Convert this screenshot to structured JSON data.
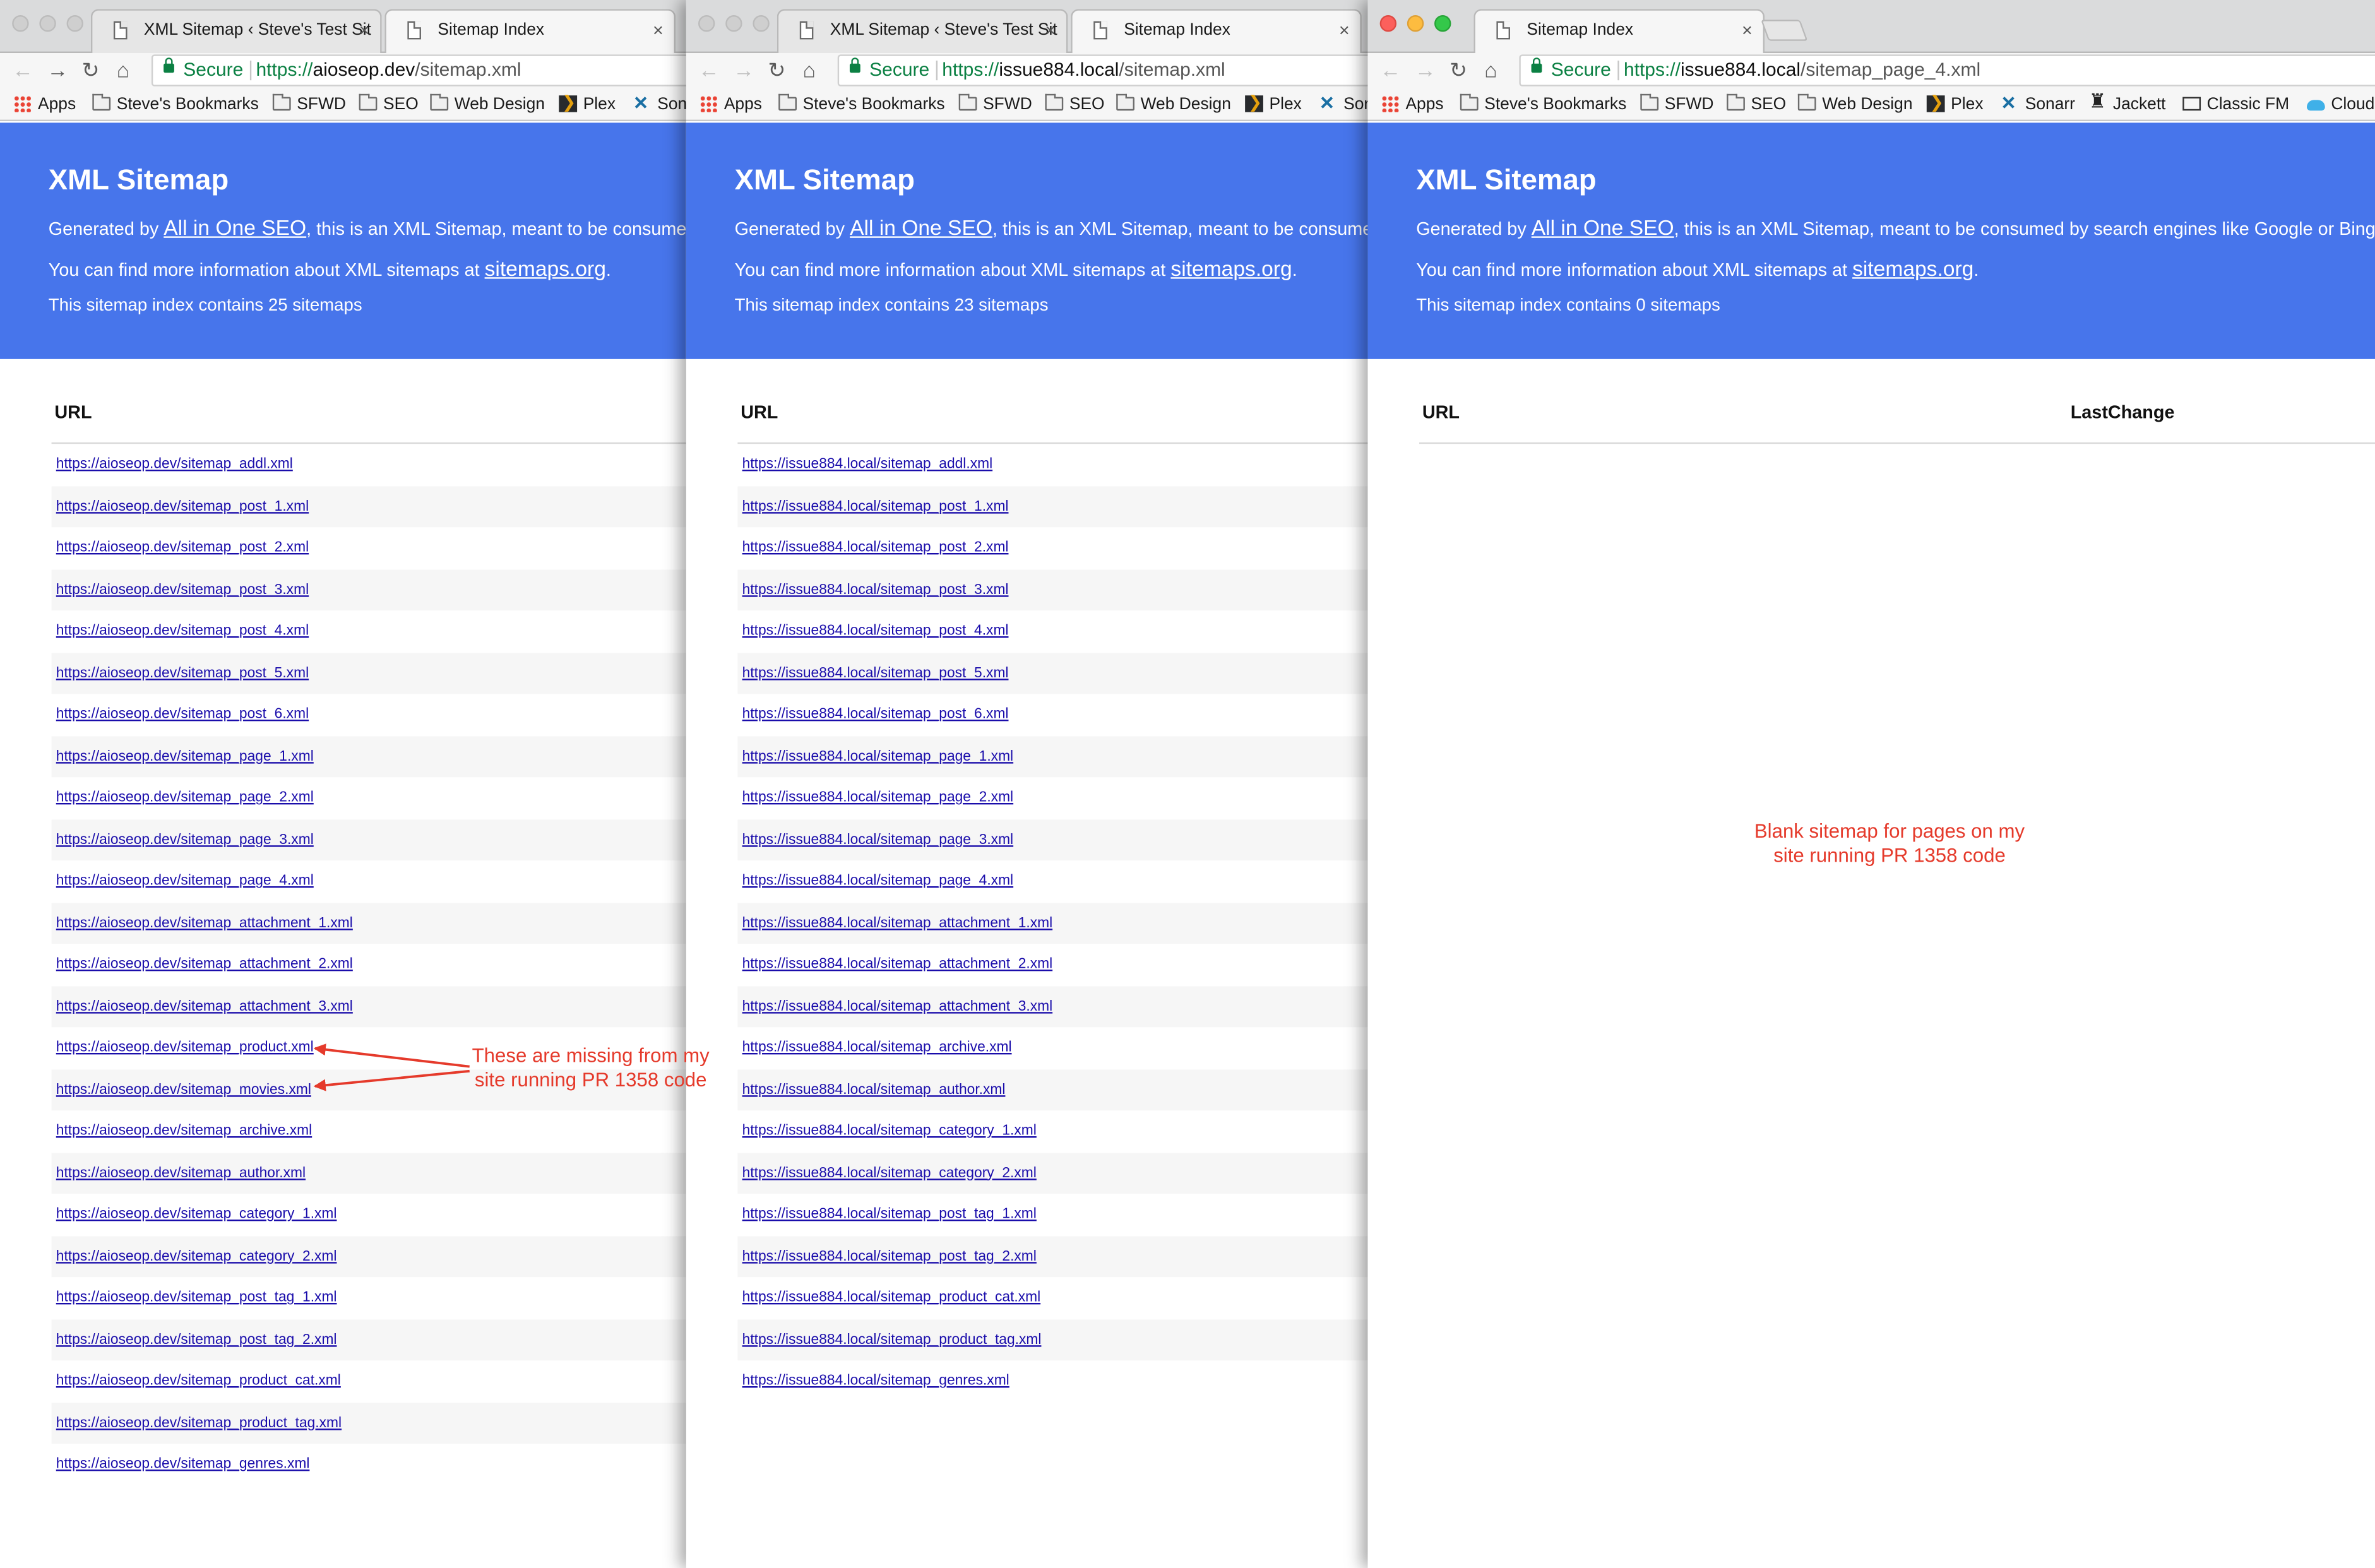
{
  "bookmarks": [
    {
      "label": "Apps",
      "icon": "apps-icon"
    },
    {
      "label": "Steve's Bookmarks",
      "icon": "folder-icon"
    },
    {
      "label": "SFWD",
      "icon": "folder-icon"
    },
    {
      "label": "SEO",
      "icon": "folder-icon"
    },
    {
      "label": "Web Design",
      "icon": "folder-icon"
    },
    {
      "label": "Plex",
      "icon": "plex-icon"
    },
    {
      "label": "Sonarr",
      "icon": "sonarr-icon"
    },
    {
      "label": "Jackett",
      "icon": "jackett-icon"
    },
    {
      "label": "Classic FM",
      "icon": "classic-fm-icon"
    },
    {
      "label": "Cloud",
      "icon": "cloud-icon"
    }
  ],
  "common": {
    "secure_label": "Secure",
    "page_title": "XML Sitemap",
    "generated_prefix": "Generated by ",
    "generator_link": "All in One SEO",
    "generated_suffix": ", this is an XML Sitemap, meant to be consumed by search engines like Google or Bing.",
    "info_prefix": "You can find more information about XML sitemaps at ",
    "info_link": "sitemaps.org",
    "info_suffix": ".",
    "col_url": "URL",
    "col_lastchange": "LastChange",
    "close_glyph": "×"
  },
  "colors": {
    "banner": "#4775eb",
    "link": "#1a0dab",
    "annotation": "#e53a2b",
    "secure": "#0b8043"
  },
  "windows": [
    {
      "tabs": [
        {
          "title": "XML Sitemap ‹ Steve's Test Site",
          "active": false
        },
        {
          "title": "Sitemap Index",
          "active": true
        }
      ],
      "url_scheme": "https://",
      "url_host": "aioseop.dev",
      "url_path": "/sitemap.xml",
      "count_text": "This sitemap index contains 25 sitemaps",
      "rows": [
        "https://aioseop.dev/sitemap_addl.xml",
        "https://aioseop.dev/sitemap_post_1.xml",
        "https://aioseop.dev/sitemap_post_2.xml",
        "https://aioseop.dev/sitemap_post_3.xml",
        "https://aioseop.dev/sitemap_post_4.xml",
        "https://aioseop.dev/sitemap_post_5.xml",
        "https://aioseop.dev/sitemap_post_6.xml",
        "https://aioseop.dev/sitemap_page_1.xml",
        "https://aioseop.dev/sitemap_page_2.xml",
        "https://aioseop.dev/sitemap_page_3.xml",
        "https://aioseop.dev/sitemap_page_4.xml",
        "https://aioseop.dev/sitemap_attachment_1.xml",
        "https://aioseop.dev/sitemap_attachment_2.xml",
        "https://aioseop.dev/sitemap_attachment_3.xml",
        "https://aioseop.dev/sitemap_product.xml",
        "https://aioseop.dev/sitemap_movies.xml",
        "https://aioseop.dev/sitemap_archive.xml",
        "https://aioseop.dev/sitemap_author.xml",
        "https://aioseop.dev/sitemap_category_1.xml",
        "https://aioseop.dev/sitemap_category_2.xml",
        "https://aioseop.dev/sitemap_post_tag_1.xml",
        "https://aioseop.dev/sitemap_post_tag_2.xml",
        "https://aioseop.dev/sitemap_product_cat.xml",
        "https://aioseop.dev/sitemap_product_tag.xml",
        "https://aioseop.dev/sitemap_genres.xml"
      ]
    },
    {
      "tabs": [
        {
          "title": "XML Sitemap ‹ Steve's Test Site",
          "active": false
        },
        {
          "title": "Sitemap Index",
          "active": true
        }
      ],
      "url_scheme": "https://",
      "url_host": "issue884.local",
      "url_path": "/sitemap.xml",
      "count_text": "This sitemap index contains 23 sitemaps",
      "rows": [
        "https://issue884.local/sitemap_addl.xml",
        "https://issue884.local/sitemap_post_1.xml",
        "https://issue884.local/sitemap_post_2.xml",
        "https://issue884.local/sitemap_post_3.xml",
        "https://issue884.local/sitemap_post_4.xml",
        "https://issue884.local/sitemap_post_5.xml",
        "https://issue884.local/sitemap_post_6.xml",
        "https://issue884.local/sitemap_page_1.xml",
        "https://issue884.local/sitemap_page_2.xml",
        "https://issue884.local/sitemap_page_3.xml",
        "https://issue884.local/sitemap_page_4.xml",
        "https://issue884.local/sitemap_attachment_1.xml",
        "https://issue884.local/sitemap_attachment_2.xml",
        "https://issue884.local/sitemap_attachment_3.xml",
        "https://issue884.local/sitemap_archive.xml",
        "https://issue884.local/sitemap_author.xml",
        "https://issue884.local/sitemap_category_1.xml",
        "https://issue884.local/sitemap_category_2.xml",
        "https://issue884.local/sitemap_post_tag_1.xml",
        "https://issue884.local/sitemap_post_tag_2.xml",
        "https://issue884.local/sitemap_product_cat.xml",
        "https://issue884.local/sitemap_product_tag.xml",
        "https://issue884.local/sitemap_genres.xml"
      ]
    },
    {
      "tabs": [
        {
          "title": "Sitemap Index",
          "active": true
        }
      ],
      "url_scheme": "https://",
      "url_host": "issue884.local",
      "url_path": "/sitemap_page_4.xml",
      "count_text": "This sitemap index contains 0 sitemaps",
      "rows": []
    }
  ],
  "annotations": {
    "missing_note_line1": "These are missing from my",
    "missing_note_line2": "site running PR 1358 code",
    "blank_note_line1": "Blank sitemap for pages on my",
    "blank_note_line2": "site running PR 1358 code"
  }
}
